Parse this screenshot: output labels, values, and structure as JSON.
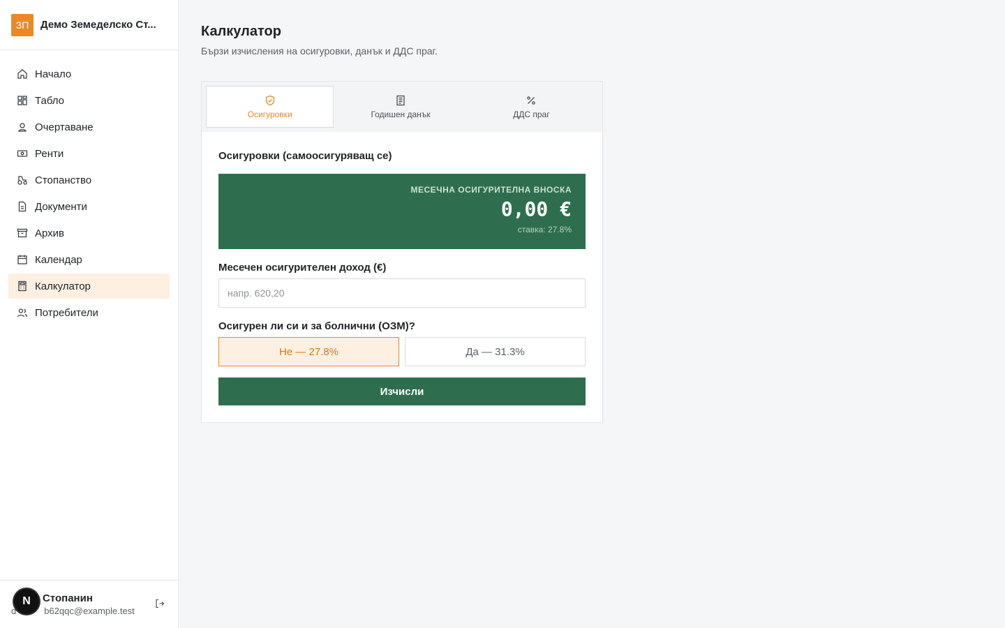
{
  "brand": {
    "logo_text": "ЗП",
    "name": "Демо Земеделско Ст..."
  },
  "sidebar": {
    "items": [
      {
        "label": "Начало",
        "icon": "home-icon"
      },
      {
        "label": "Табло",
        "icon": "dashboard-icon"
      },
      {
        "label": "Очертаване",
        "icon": "map-pin-icon"
      },
      {
        "label": "Ренти",
        "icon": "banknote-icon"
      },
      {
        "label": "Стопанство",
        "icon": "tractor-icon"
      },
      {
        "label": "Документи",
        "icon": "document-icon"
      },
      {
        "label": "Архив",
        "icon": "archive-icon"
      },
      {
        "label": "Календар",
        "icon": "calendar-icon"
      },
      {
        "label": "Калкулатор",
        "icon": "calculator-icon",
        "active": true
      },
      {
        "label": "Потребители",
        "icon": "users-icon"
      }
    ]
  },
  "user": {
    "name": "Стопанин",
    "email": "b62qqc@example.test",
    "email_prefix": "d"
  },
  "page": {
    "title": "Калкулатор",
    "subtitle": "Бързи изчисления на осигуровки, данък и ДДС праг."
  },
  "tabs": [
    {
      "label": "Осигуровки",
      "icon": "shield-check-icon",
      "active": true
    },
    {
      "label": "Годишен данък",
      "icon": "receipt-icon"
    },
    {
      "label": "ДДС праг",
      "icon": "percent-icon"
    }
  ],
  "calculator": {
    "section_title": "Осигуровки (самоосигуряващ се)",
    "result_label": "МЕСЕЧНА ОСИГУРИТЕЛНА ВНОСКА",
    "result_value": "0,00 €",
    "result_rate": "ставка: 27.8%",
    "income_label": "Месечен осигурителен доход (€)",
    "income_placeholder": "напр. 620,20",
    "income_value": "",
    "sick_label": "Осигурен ли си и за болнични (ОЗМ)?",
    "option_no": "Не — 27.8%",
    "option_yes": "Да — 31.3%",
    "selected_option": "no",
    "submit_label": "Изчисли"
  },
  "colors": {
    "accent": "#e8892a",
    "green": "#2e6e4e",
    "active_bg": "#fdf0e1"
  }
}
